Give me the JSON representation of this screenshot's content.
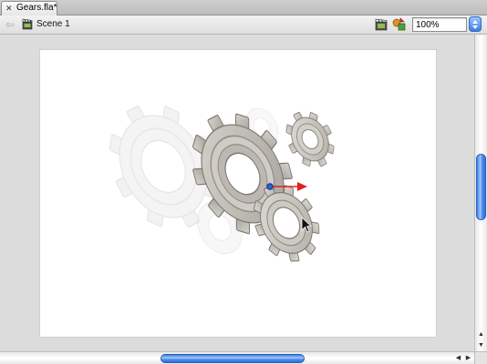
{
  "document": {
    "tab_title": "Gears.fla*",
    "close_glyph": "✕"
  },
  "editbar": {
    "back_glyph": "⇦",
    "scene_label": "Scene 1",
    "zoom_value": "100%",
    "icons": {
      "scene": "clapperboard-icon",
      "edit_scene": "edit-scene-icon",
      "edit_symbol": "edit-symbols-icon",
      "zoom": "stepper-icon"
    }
  },
  "scrollbars": {
    "up_glyph": "▲",
    "down_glyph": "▼",
    "left_glyph": "◀",
    "right_glyph": "▶"
  },
  "colors": {
    "accent": "#3b7de0",
    "motion_arrow": "#e02020",
    "registration_point": "#2255cc",
    "gear_main": "#b8b4ae",
    "gear_onion": "#e6e6e6"
  }
}
